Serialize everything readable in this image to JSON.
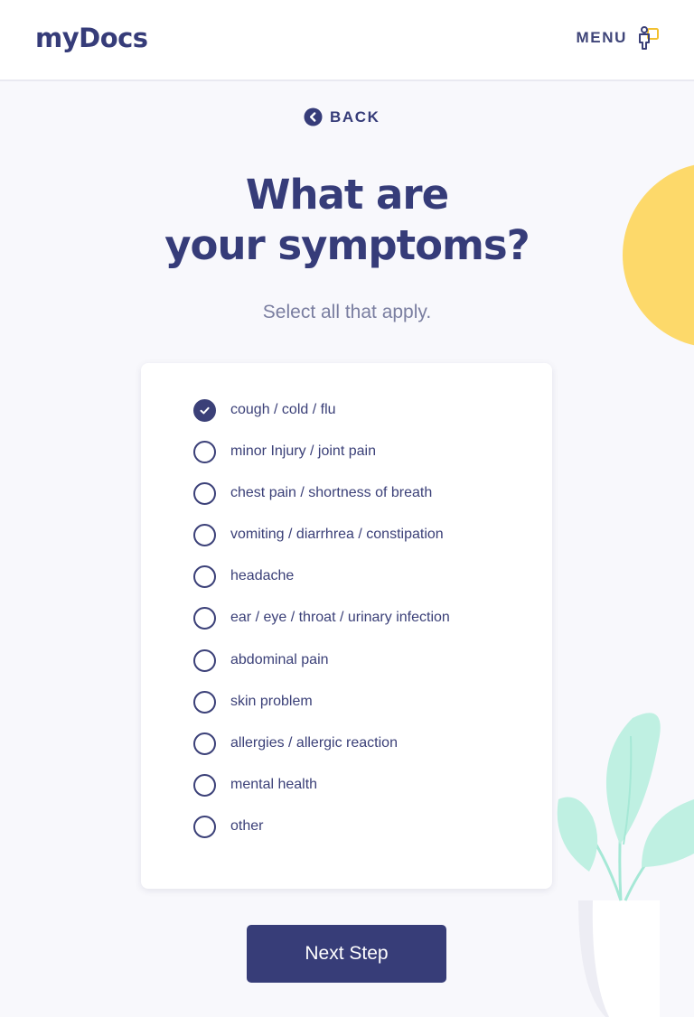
{
  "header": {
    "logo": "myDocs",
    "menu_label": "MENU",
    "menu_icon": "person-chat-icon"
  },
  "back": {
    "label": "BACK",
    "icon": "chevron-left-circle-icon"
  },
  "title": {
    "line1": "What are",
    "line2": "your symptoms?"
  },
  "subtitle": "Select all that apply.",
  "options": [
    {
      "label": "cough / cold / flu",
      "checked": true
    },
    {
      "label": "minor Injury / joint pain",
      "checked": false
    },
    {
      "label": "chest pain / shortness of breath",
      "checked": false
    },
    {
      "label": "vomiting / diarrhrea / constipation",
      "checked": false
    },
    {
      "label": "headache",
      "checked": false
    },
    {
      "label": "ear / eye / throat / urinary infection",
      "checked": false
    },
    {
      "label": "abdominal pain",
      "checked": false
    },
    {
      "label": "skin problem",
      "checked": false
    },
    {
      "label": "allergies / allergic reaction",
      "checked": false
    },
    {
      "label": "mental health",
      "checked": false
    },
    {
      "label": "other",
      "checked": false
    }
  ],
  "next_button": "Next Step",
  "colors": {
    "primary": "#373d78",
    "accent_yellow": "#fdd96a",
    "leaf_mint": "#bff0e2",
    "background": "#f8f8fc"
  }
}
